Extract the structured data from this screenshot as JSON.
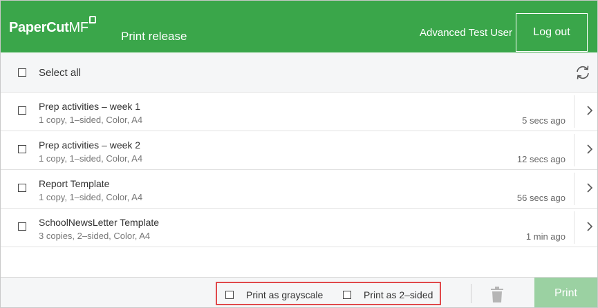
{
  "header": {
    "brand_main": "PaperCut",
    "brand_suffix": "MF",
    "app_title": "Print release",
    "user_name": "Advanced Test User",
    "logout_label": "Log out",
    "color": "#3aa64a"
  },
  "toolbar": {
    "select_all_label": "Select all",
    "refresh_icon": "refresh-icon"
  },
  "jobs": [
    {
      "name": "Prep activities – week 1",
      "details": "1 copy, 1–sided, Color, A4",
      "time": "5 secs ago"
    },
    {
      "name": "Prep activities – week 2",
      "details": "1 copy, 1–sided, Color, A4",
      "time": "12 secs ago"
    },
    {
      "name": "Report Template",
      "details": "1 copy, 1–sided, Color, A4",
      "time": "56 secs ago"
    },
    {
      "name": "SchoolNewsLetter Template",
      "details": "3 copies, 2–sided, Color, A4",
      "time": "1 min ago"
    }
  ],
  "footer": {
    "grayscale_label": "Print as grayscale",
    "two_sided_label": "Print as 2–sided",
    "print_label": "Print",
    "highlight_color": "#e0484a",
    "print_button_color": "#9bd1a2"
  }
}
